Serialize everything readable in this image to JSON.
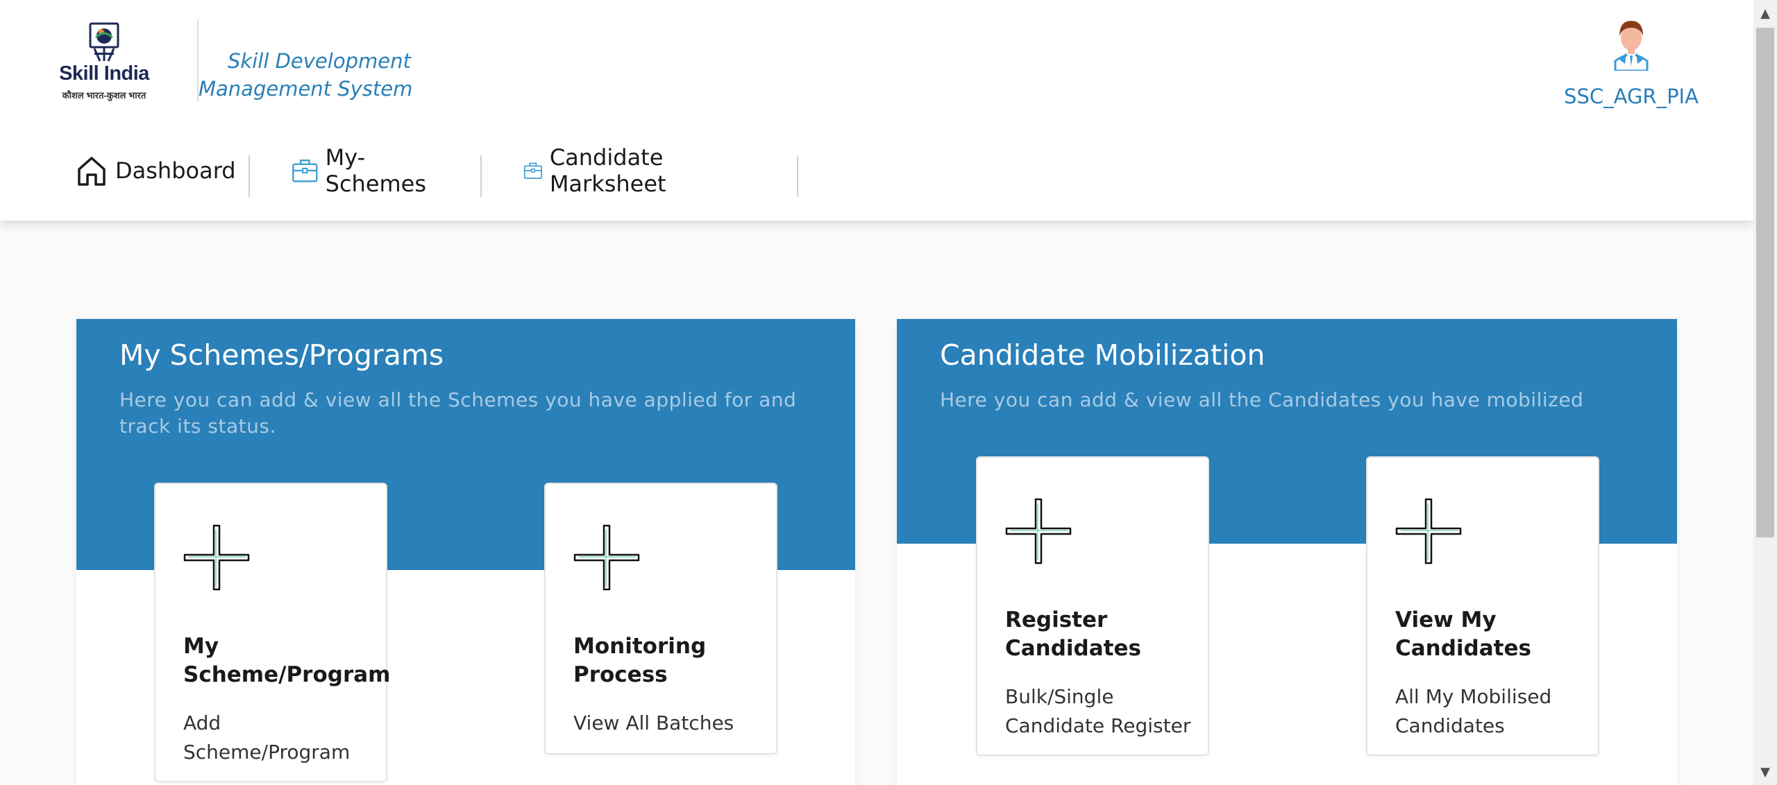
{
  "brand": {
    "logo_title": "Skill India",
    "logo_subtitle": "कौशल भारत-कुशल भारत",
    "app_title": "Skill Development Management System"
  },
  "user": {
    "name": "SSC_AGR_PIA",
    "avatar_icon": "user-avatar-icon"
  },
  "nav": {
    "items": [
      {
        "label": "Dashboard",
        "icon": "home-icon"
      },
      {
        "label": "My-Schemes",
        "icon": "briefcase-icon"
      },
      {
        "label": "Candidate Marksheet",
        "icon": "briefcase-icon"
      }
    ]
  },
  "panels": {
    "schemes": {
      "title": "My Schemes/Programs",
      "description": "Here you can add & view all the Schemes you have applied for and track its status.",
      "cards": [
        {
          "title": "My Scheme/Program",
          "subtitle": "Add Scheme/Program",
          "icon": "plus-icon"
        },
        {
          "title": "Monitoring Process",
          "subtitle": "View All Batches",
          "icon": "plus-icon"
        }
      ]
    },
    "mobilization": {
      "title": "Candidate Mobilization",
      "description": "Here you can add & view all the Candidates you have mobilized",
      "cards": [
        {
          "title": "Register Candidates",
          "subtitle": "Bulk/Single Candidate Register",
          "icon": "plus-icon"
        },
        {
          "title": "View My Candidates",
          "subtitle": "All My Mobilised Candidates",
          "icon": "plus-icon"
        }
      ]
    }
  },
  "colors": {
    "brand_blue": "#2a80b9",
    "link_blue": "#2a7fb8",
    "icon_blue": "#3a9bd5"
  }
}
